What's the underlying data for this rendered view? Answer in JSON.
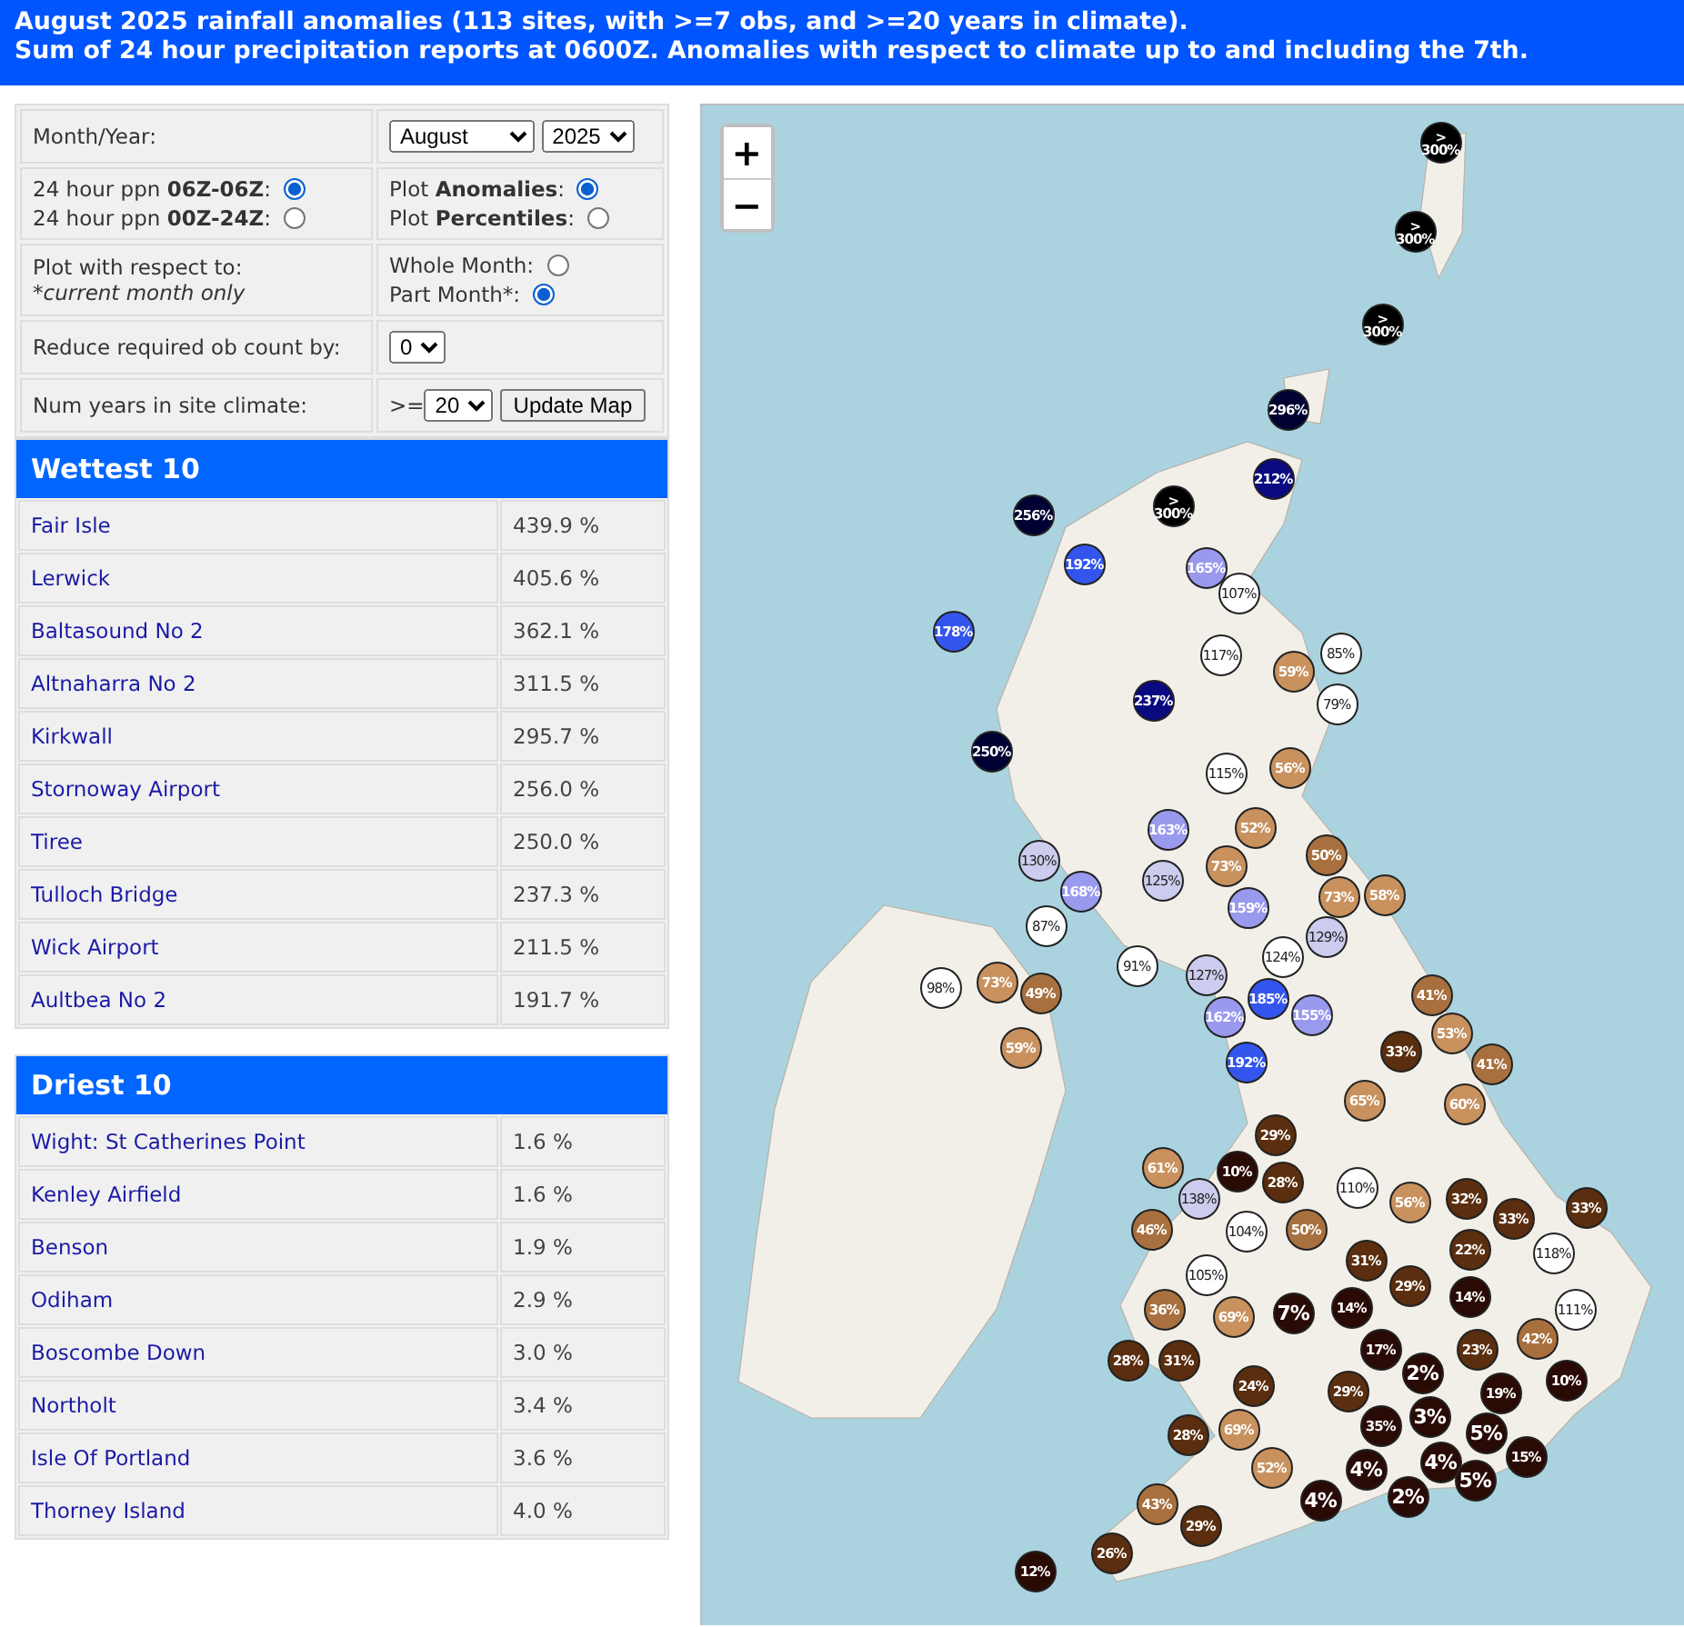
{
  "header": {
    "lines": [
      "August 2025 rainfall anomalies (113 sites, with >=7 obs, and >=20 years in climate).",
      "Sum of 24 hour precipitation reports at 0600Z. Anomalies with respect to climate up to and including the 7th."
    ]
  },
  "controls": {
    "month_label": "Month/Year:",
    "month": "August",
    "year": "2025",
    "period_options": [
      {
        "label": "24 hour ppn **06Z-06Z**:",
        "selected": true
      },
      {
        "label": "24 hour ppn **00Z-24Z**:",
        "selected": false
      }
    ],
    "plot_options": [
      {
        "label": "Plot **Anomalies**:",
        "selected": true
      },
      {
        "label": "Plot **Percentiles**:",
        "selected": false
      }
    ],
    "respect_label": "Plot with respect to:",
    "respect_note": "*current month only",
    "range_options": [
      {
        "label": "Whole Month:",
        "selected": false
      },
      {
        "label": "Part Month*:",
        "selected": true
      }
    ],
    "reduce_label": "Reduce required ob count by:",
    "reduce_value": "0",
    "years_label": "Num years in site climate:",
    "years_prefix": ">=",
    "years_value": "20",
    "update_button": "Update Map"
  },
  "wettest": {
    "title": "Wettest 10",
    "rows": [
      {
        "site": "Fair Isle",
        "value": "439.9 %"
      },
      {
        "site": "Lerwick",
        "value": "405.6 %"
      },
      {
        "site": "Baltasound No 2",
        "value": "362.1 %"
      },
      {
        "site": "Altnaharra No 2",
        "value": "311.5 %"
      },
      {
        "site": "Kirkwall",
        "value": "295.7 %"
      },
      {
        "site": "Stornoway Airport",
        "value": "256.0 %"
      },
      {
        "site": "Tiree",
        "value": "250.0 %"
      },
      {
        "site": "Tulloch Bridge",
        "value": "237.3 %"
      },
      {
        "site": "Wick Airport",
        "value": "211.5 %"
      },
      {
        "site": "Aultbea No 2",
        "value": "191.7 %"
      }
    ]
  },
  "driest": {
    "title": "Driest 10",
    "rows": [
      {
        "site": "Wight: St Catherines Point",
        "value": "1.6 %"
      },
      {
        "site": "Kenley Airfield",
        "value": "1.6 %"
      },
      {
        "site": "Benson",
        "value": "1.9 %"
      },
      {
        "site": "Odiham",
        "value": "2.9 %"
      },
      {
        "site": "Boscombe Down",
        "value": "3.0 %"
      },
      {
        "site": "Northolt",
        "value": "3.4 %"
      },
      {
        "site": "Isle Of Portland",
        "value": "3.6 %"
      },
      {
        "site": "Thorney Island",
        "value": "4.0 %"
      }
    ]
  },
  "map": {
    "zoom_in": "+",
    "zoom_out": "−",
    "markers": [
      {
        "label": ">300%",
        "color": "#000000"
      },
      {
        "label": ">300%",
        "color": "#000000"
      },
      {
        "label": ">300%",
        "color": "#000000"
      },
      {
        "label": "296%",
        "color": "#000033"
      },
      {
        "label": "212%",
        "color": "#0a0a80"
      },
      {
        "label": ">300%",
        "color": "#000000"
      },
      {
        "label": "256%",
        "color": "#000033"
      },
      {
        "label": "192%",
        "color": "#3355ee"
      },
      {
        "label": "165%",
        "color": "#9999ee"
      },
      {
        "label": "107%",
        "color": "#ffffff"
      },
      {
        "label": "178%",
        "color": "#3355ee"
      },
      {
        "label": "117%",
        "color": "#ffffff"
      },
      {
        "label": "85%",
        "color": "#ffffff"
      },
      {
        "label": "59%",
        "color": "#c8915e"
      },
      {
        "label": "79%",
        "color": "#ffffff"
      },
      {
        "label": "237%",
        "color": "#0a0a80"
      },
      {
        "label": "250%",
        "color": "#000033"
      },
      {
        "label": "115%",
        "color": "#ffffff"
      },
      {
        "label": "56%",
        "color": "#c8915e"
      },
      {
        "label": "163%",
        "color": "#9999ee"
      },
      {
        "label": "52%",
        "color": "#c8915e"
      },
      {
        "label": "50%",
        "color": "#a8703e"
      },
      {
        "label": "130%",
        "color": "#ccccee"
      },
      {
        "label": "73%",
        "color": "#c8915e"
      },
      {
        "label": "125%",
        "color": "#ccccee"
      },
      {
        "label": "168%",
        "color": "#9999ee"
      },
      {
        "label": "58%",
        "color": "#c8915e"
      },
      {
        "label": "159%",
        "color": "#9999ee"
      },
      {
        "label": "73%",
        "color": "#c8915e"
      },
      {
        "label": "87%",
        "color": "#ffffff"
      },
      {
        "label": "129%",
        "color": "#ccccee"
      },
      {
        "label": "124%",
        "color": "#ffffff"
      },
      {
        "label": "91%",
        "color": "#ffffff"
      },
      {
        "label": "127%",
        "color": "#ccccee"
      },
      {
        "label": "98%",
        "color": "#ffffff"
      },
      {
        "label": "73%",
        "color": "#c8915e"
      },
      {
        "label": "49%",
        "color": "#a8703e"
      },
      {
        "label": "162%",
        "color": "#9999ee"
      },
      {
        "label": "185%",
        "color": "#3355ee"
      },
      {
        "label": "155%",
        "color": "#9999ee"
      },
      {
        "label": "41%",
        "color": "#a8703e"
      },
      {
        "label": "53%",
        "color": "#c8915e"
      },
      {
        "label": "33%",
        "color": "#5a2e0e"
      },
      {
        "label": "192%",
        "color": "#3355ee"
      },
      {
        "label": "59%",
        "color": "#c8915e"
      },
      {
        "label": "41%",
        "color": "#a8703e"
      },
      {
        "label": "65%",
        "color": "#c8915e"
      },
      {
        "label": "60%",
        "color": "#c8915e"
      },
      {
        "label": "29%",
        "color": "#5a2e0e"
      },
      {
        "label": "10%",
        "color": "#2a0a05"
      },
      {
        "label": "28%",
        "color": "#5a2e0e"
      },
      {
        "label": "61%",
        "color": "#c8915e"
      },
      {
        "label": "138%",
        "color": "#ccccee"
      },
      {
        "label": "110%",
        "color": "#ffffff"
      },
      {
        "label": "56%",
        "color": "#c8915e"
      },
      {
        "label": "32%",
        "color": "#5a2e0e"
      },
      {
        "label": "33%",
        "color": "#5a2e0e"
      },
      {
        "label": "33%",
        "color": "#5a2e0e"
      },
      {
        "label": "46%",
        "color": "#a8703e"
      },
      {
        "label": "104%",
        "color": "#ffffff"
      },
      {
        "label": "50%",
        "color": "#a8703e"
      },
      {
        "label": "22%",
        "color": "#5a2e0e"
      },
      {
        "label": "118%",
        "color": "#ffffff"
      },
      {
        "label": "31%",
        "color": "#5a2e0e"
      },
      {
        "label": "29%",
        "color": "#5a2e0e"
      },
      {
        "label": "105%",
        "color": "#ffffff"
      },
      {
        "label": "14%",
        "color": "#2a0a05"
      },
      {
        "label": "36%",
        "color": "#a8703e"
      },
      {
        "label": "69%",
        "color": "#c8915e"
      },
      {
        "label": "7%",
        "color": "#2a0a05"
      },
      {
        "label": "14%",
        "color": "#2a0a05"
      },
      {
        "label": "111%",
        "color": "#ffffff"
      },
      {
        "label": "42%",
        "color": "#a8703e"
      },
      {
        "label": "17%",
        "color": "#2a0a05"
      },
      {
        "label": "23%",
        "color": "#5a2e0e"
      },
      {
        "label": "2%",
        "color": "#2a0a05"
      },
      {
        "label": "28%",
        "color": "#5a2e0e"
      },
      {
        "label": "31%",
        "color": "#5a2e0e"
      },
      {
        "label": "29%",
        "color": "#5a2e0e"
      },
      {
        "label": "10%",
        "color": "#2a0a05"
      },
      {
        "label": "19%",
        "color": "#2a0a05"
      },
      {
        "label": "24%",
        "color": "#5a2e0e"
      },
      {
        "label": "28%",
        "color": "#5a2e0e"
      },
      {
        "label": "69%",
        "color": "#c8915e"
      },
      {
        "label": "35%",
        "color": "#2a0a05"
      },
      {
        "label": "3%",
        "color": "#2a0a05"
      },
      {
        "label": "5%",
        "color": "#2a0a05"
      },
      {
        "label": "52%",
        "color": "#c8915e"
      },
      {
        "label": "4%",
        "color": "#2a0a05"
      },
      {
        "label": "4%",
        "color": "#2a0a05"
      },
      {
        "label": "5%",
        "color": "#2a0a05"
      },
      {
        "label": "15%",
        "color": "#2a0a05"
      },
      {
        "label": "43%",
        "color": "#a8703e"
      },
      {
        "label": "29%",
        "color": "#5a2e0e"
      },
      {
        "label": "26%",
        "color": "#5a2e0e"
      },
      {
        "label": "12%",
        "color": "#2a0a05"
      },
      {
        "label": "4%",
        "color": "#2a0a05"
      },
      {
        "label": "2%",
        "color": "#2a0a05"
      }
    ]
  }
}
